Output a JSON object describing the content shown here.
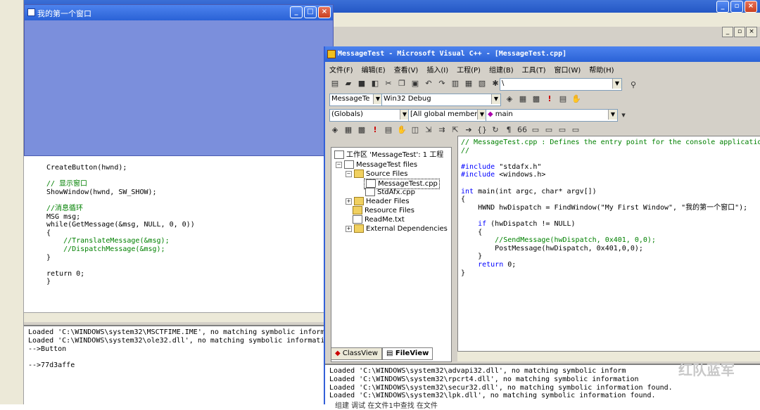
{
  "background_ide": {
    "left_code": [
      {
        "text": "CreateButton(hwnd);",
        "kind": "plain"
      },
      {
        "text": "",
        "kind": "plain"
      },
      {
        "text": "// 显示窗口",
        "kind": "comment"
      },
      {
        "text": "ShowWindow(hwnd, SW_SHOW);",
        "kind": "plain"
      },
      {
        "text": "",
        "kind": "plain"
      },
      {
        "text": "//消息循环",
        "kind": "comment"
      },
      {
        "text": "MSG msg;",
        "kind": "plain"
      },
      {
        "text": "while(GetMessage(&msg, NULL, 0, 0))",
        "kind": "plain"
      },
      {
        "text": "{",
        "kind": "plain"
      },
      {
        "text": "    //TranslateMessage(&msg);",
        "kind": "comment"
      },
      {
        "text": "    //DispatchMessage(&msg);",
        "kind": "comment"
      },
      {
        "text": "}",
        "kind": "plain"
      },
      {
        "text": "",
        "kind": "plain"
      },
      {
        "text": "return 0;",
        "kind": "plain"
      },
      {
        "text": "}",
        "kind": "plain"
      }
    ],
    "output_lines": [
      "Loaded 'C:\\WINDOWS\\system32\\MSCTFIME.IME', no matching symbolic informa",
      "Loaded 'C:\\WINDOWS\\system32\\ole32.dll', no matching symbolic informatio",
      "-->Button",
      "",
      "-->77d3affe"
    ]
  },
  "app_window": {
    "title": "我的第一个窗口"
  },
  "vc": {
    "title": "MessageTest - Microsoft Visual C++ - [MessageTest.cpp]",
    "menu": [
      "文件(F)",
      "编辑(E)",
      "查看(V)",
      "插入(I)",
      "工程(P)",
      "组建(B)",
      "工具(T)",
      "窗口(W)",
      "帮助(H)"
    ],
    "find_combo": "\\",
    "project_combo": "MessageTe",
    "config_combo": "Win32 Debug",
    "globals_combo": "(Globals)",
    "members_combo": "[All global members",
    "function_combo": "main",
    "workspace": {
      "root": "工作区 'MessageTest': 1 工程",
      "project": "MessageTest files",
      "source_files": "Source Files",
      "file1": "MessageTest.cpp",
      "file2": "StdAfx.cpp",
      "header_files": "Header Files",
      "resource_files": "Resource Files",
      "readme": "ReadMe.txt",
      "external": "External Dependencies",
      "tab_class": "ClassView",
      "tab_file": "FileView"
    },
    "code": [
      {
        "text": "// MessageTest.cpp : Defines the entry point for the console applicatio",
        "kind": "comment"
      },
      {
        "text": "//",
        "kind": "comment"
      },
      {
        "text": "",
        "kind": "plain"
      },
      {
        "text": "#include \"stdafx.h\"",
        "kind": "include"
      },
      {
        "text": "#include <windows.h>",
        "kind": "include"
      },
      {
        "text": "",
        "kind": "plain"
      },
      {
        "text": "int main(int argc, char* argv[])",
        "kind": "sig"
      },
      {
        "text": "{",
        "kind": "plain"
      },
      {
        "text": "    HWND hwDispatch = FindWindow(\"My First Window\", \"我的第一个窗口\");",
        "kind": "plain"
      },
      {
        "text": "",
        "kind": "plain"
      },
      {
        "text": "    if (hwDispatch != NULL)",
        "kind": "if"
      },
      {
        "text": "    {",
        "kind": "plain"
      },
      {
        "text": "        //SendMessage(hwDispatch, 0x401, 0,0);",
        "kind": "comment"
      },
      {
        "text": "        PostMessage(hwDispatch, 0x401,0,0);",
        "kind": "plain"
      },
      {
        "text": "    }",
        "kind": "plain"
      },
      {
        "text": "    return 0;",
        "kind": "return"
      },
      {
        "text": "}",
        "kind": "plain"
      }
    ],
    "output_lines": [
      "Loaded 'C:\\WINDOWS\\system32\\advapi32.dll', no matching symbolic inform",
      "Loaded 'C:\\WINDOWS\\system32\\rpcrt4.dll', no matching symbolic information",
      "Loaded 'C:\\WINDOWS\\system32\\secur32.dll', no matching symbolic information found.",
      "Loaded 'C:\\WINDOWS\\system32\\lpk.dll', no matching symbolic information found."
    ],
    "bottom_tabs": "组建 调试 在文件1中查找 在文件"
  },
  "watermark": "红队蓝军"
}
